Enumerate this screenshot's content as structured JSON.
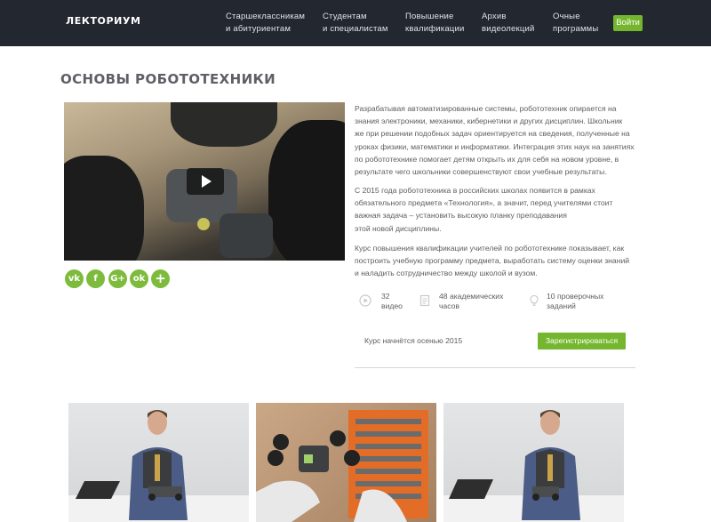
{
  "header": {
    "logo": "ЛЕКТОРИУМ",
    "nav": [
      {
        "line1": "Старшеклассникам",
        "line2": "и абитуриентам"
      },
      {
        "line1": "Студентам",
        "line2": "и специалистам"
      },
      {
        "line1": "Повышение",
        "line2": "квалификации"
      },
      {
        "line1": "Архив",
        "line2": "видеолекций"
      },
      {
        "line1": "Очные",
        "line2": "программы"
      }
    ],
    "login": "Войти"
  },
  "page_title": "ОСНОВЫ РОБОТОТЕХНИКИ",
  "social": [
    {
      "icon": "vk-icon",
      "glyph": "vk"
    },
    {
      "icon": "facebook-icon",
      "glyph": "f"
    },
    {
      "icon": "google-plus-icon",
      "glyph": "G+"
    },
    {
      "icon": "odnoklassniki-icon",
      "glyph": "ok"
    },
    {
      "icon": "add-share-icon",
      "glyph": "+"
    }
  ],
  "description": {
    "p1": [
      "Разрабатывая автоматизированные системы, робототехник опирается на",
      "знания электроники, механики, кибернетики и других дисциплин. Школьник",
      "же при решении подобных задач ориентируется на сведения, полученные на",
      "уроках физики, математики и информатики. Интеграция этих наук на занятиях",
      "по робототехнике помогает детям открыть их для себя на новом уровне, в",
      "результате чего школьники совершенствуют свои учебные результаты."
    ],
    "p2": [
      "С 2015 года робототехника в российских школах появится в рамках",
      "обязательного предмета «Технология», а значит, перед учителями стоит",
      "важная задача – установить высокую планку преподавания",
      "этой новой дисциплины."
    ],
    "p3": [
      "Курс повышения квалификации учителей по робототехнике показывает, как",
      "построить учебную программу предмета, выработать систему оценки знаний",
      "и наладить сотрудничество между школой и вузом."
    ]
  },
  "stats": [
    {
      "icon": "play-circle-icon",
      "line1": "32",
      "line2": "видео"
    },
    {
      "icon": "document-icon",
      "line1": "48 академических",
      "line2": "часов"
    },
    {
      "icon": "lightbulb-icon",
      "line1": "10 проверочных",
      "line2": "заданий"
    }
  ],
  "course_start": "Курс начнётся осенью 2015",
  "register": "Зарегистрироваться",
  "colors": {
    "header_bg": "#232730",
    "accent": "#74b72e",
    "social": "#7dbb3c"
  }
}
